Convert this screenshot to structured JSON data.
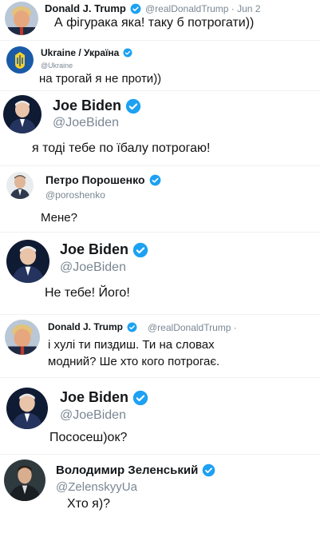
{
  "tweets": [
    {
      "name": "Donald J. Trump",
      "handle": "@realDonaldTrump · Jun 2",
      "text": [
        "А фігурака яка! таку б потрогати))"
      ]
    },
    {
      "name": "Ukraine / Україна",
      "handle": "@Ukraine",
      "text": [
        "на трогай я не проти))"
      ]
    },
    {
      "name": "Joe Biden",
      "handle": "@JoeBiden",
      "text": [
        "я тоді тебе по їбалу потрогаю!"
      ]
    },
    {
      "name": "Петро Порошенко",
      "handle": "@poroshenko",
      "text": [
        "Мене?"
      ]
    },
    {
      "name": "Joe Biden",
      "handle": "@JoeBiden",
      "text": [
        "Не тебе! Його!"
      ]
    },
    {
      "name": "Donald J. Trump",
      "handle": "@realDonaldTrump ·",
      "text": [
        "і хулі ти пиздиш. Ти на словах",
        "модний? Ше хто кого потрогає."
      ]
    },
    {
      "name": "Joe Biden",
      "handle": "@JoeBiden",
      "text": [
        "Пососеш)ок?"
      ]
    },
    {
      "name": "Володимир Зеленський",
      "handle": "@ZelenskyyUa",
      "text": [
        "Хто я)?"
      ]
    }
  ],
  "colors": {
    "verified": "#1da1f2",
    "handle": "#7a8793",
    "text": "#111111"
  },
  "icons": [
    "verified-badge-icon"
  ]
}
